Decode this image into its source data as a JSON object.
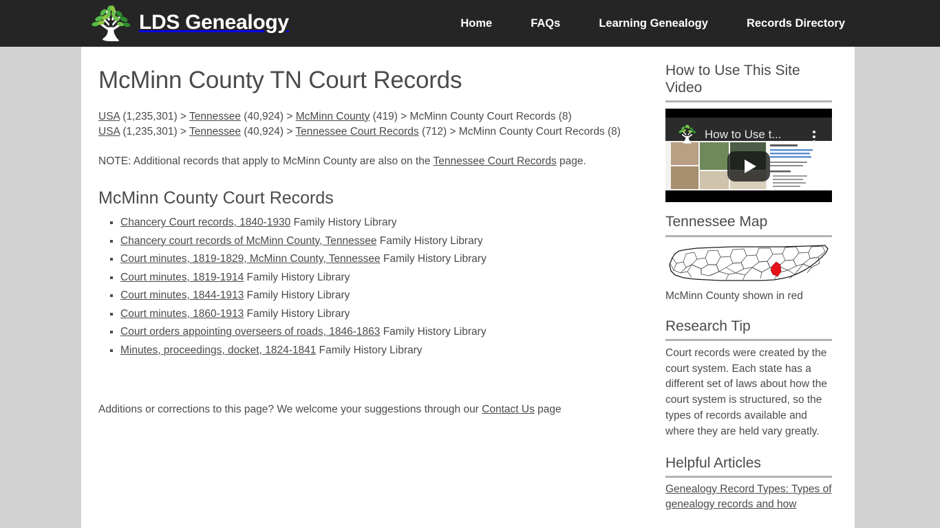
{
  "header": {
    "brand_name": "LDS Genealogy",
    "logo_icon": "tree-logo-icon",
    "nav": [
      {
        "label": "Home"
      },
      {
        "label": "FAQs"
      },
      {
        "label": "Learning Genealogy"
      },
      {
        "label": "Records Directory"
      }
    ]
  },
  "main": {
    "page_title": "McMinn County TN Court Records",
    "breadcrumbs": [
      {
        "parts": [
          {
            "text": "USA",
            "link": true
          },
          {
            "text": " (1,235,301) > ",
            "link": false
          },
          {
            "text": "Tennessee",
            "link": true
          },
          {
            "text": " (40,924) > ",
            "link": false
          },
          {
            "text": "McMinn County",
            "link": true
          },
          {
            "text": " (419) > McMinn County Court Records (8)",
            "link": false
          }
        ]
      },
      {
        "parts": [
          {
            "text": "USA",
            "link": true
          },
          {
            "text": " (1,235,301) > ",
            "link": false
          },
          {
            "text": "Tennessee",
            "link": true
          },
          {
            "text": " (40,924) > ",
            "link": false
          },
          {
            "text": "Tennessee Court Records",
            "link": true
          },
          {
            "text": " (712) > McMinn County Court Records (8)",
            "link": false
          }
        ]
      }
    ],
    "note": {
      "before": "NOTE: Additional records that apply to McMinn County are also on the ",
      "link": "Tennessee Court Records",
      "after": " page."
    },
    "section_heading": "McMinn County Court Records",
    "records": [
      {
        "link": "Chancery Court records, 1840-1930",
        "source": "Family History Library"
      },
      {
        "link": "Chancery court records of McMinn County, Tennessee",
        "source": "Family History Library"
      },
      {
        "link": "Court minutes, 1819-1829, McMinn County, Tennessee",
        "source": "Family History Library"
      },
      {
        "link": "Court minutes, 1819-1914",
        "source": "Family History Library"
      },
      {
        "link": "Court minutes, 1844-1913",
        "source": "Family History Library"
      },
      {
        "link": "Court minutes, 1860-1913",
        "source": "Family History Library"
      },
      {
        "link": "Court orders appointing overseers of roads, 1846-1863",
        "source": "Family History Library"
      },
      {
        "link": "Minutes, proceedings, docket, 1824-1841",
        "source": "Family History Library"
      }
    ],
    "footnote": {
      "before": "Additions or corrections to this page? We welcome your suggestions through our ",
      "link": "Contact Us",
      "after": " page"
    }
  },
  "sidebar": {
    "video": {
      "heading": "How to Use This Site Video",
      "player_title": "How to Use t...",
      "play_icon": "play-button-icon",
      "kebab_icon": "more-options-icon",
      "logo_icon": "tree-logo-icon"
    },
    "map": {
      "heading": "Tennessee Map",
      "caption": "McMinn County shown in red",
      "highlight_color": "#e8101a",
      "image_name": "tennessee-county-map"
    },
    "research_tip": {
      "heading": "Research Tip",
      "body": "Court records were created by the court system. Each state has a different set of laws about how the court system is structured, so the types of records available and where they are held vary greatly."
    },
    "helpful_articles": {
      "heading": "Helpful Articles",
      "items": [
        {
          "label": "Genealogy Record Types: Types of genealogy records and how"
        }
      ]
    }
  },
  "colors": {
    "header_bg": "#252525",
    "page_bg": "#d3d3d3",
    "content_bg": "#ffffff",
    "text": "#4a4a4a",
    "rule": "#b3b3b3"
  }
}
